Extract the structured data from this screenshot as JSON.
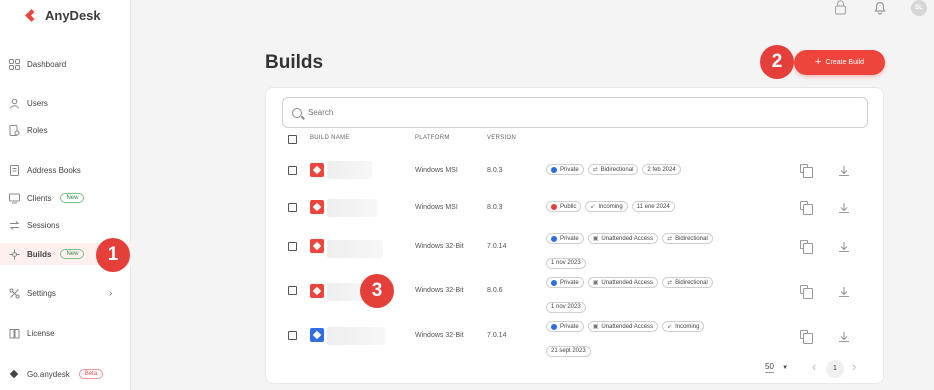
{
  "app": {
    "brand": "AnyDesk"
  },
  "sidebar": {
    "items": [
      {
        "label": "Dashboard",
        "icon": "grid-icon"
      },
      {
        "label": "Users",
        "icon": "user-icon"
      },
      {
        "label": "Roles",
        "icon": "roles-icon"
      },
      {
        "label": "Address Books",
        "icon": "address-book-icon"
      },
      {
        "label": "Clients",
        "icon": "monitor-icon",
        "badge": "New"
      },
      {
        "label": "Sessions",
        "icon": "sessions-icon"
      },
      {
        "label": "Builds",
        "icon": "builds-icon",
        "badge": "New",
        "active": true
      },
      {
        "label": "Settings",
        "icon": "settings-icon"
      },
      {
        "label": "License",
        "icon": "license-icon"
      },
      {
        "label": "Go.anydesk",
        "icon": "go-anydesk-icon",
        "badge": "Beta"
      }
    ]
  },
  "header": {
    "avatar_initials": "SL",
    "icons": [
      "lock-icon",
      "bell-icon"
    ]
  },
  "main": {
    "title": "Builds",
    "create_button": "Create Build",
    "search_placeholder": "Search",
    "columns": [
      "BUILD NAME",
      "PLATFORM",
      "VERSION"
    ],
    "rows": [
      {
        "icon_color": "red",
        "platform": "Windows MSI",
        "version": "8.0.3",
        "tags": [
          {
            "label": "Private",
            "dot": "blue"
          },
          {
            "label": "Bidirectional",
            "icon": "bidirectional-icon"
          },
          {
            "label": "2 feb 2024"
          }
        ]
      },
      {
        "icon_color": "red",
        "platform": "Windows MSI",
        "version": "8.0.3",
        "tags": [
          {
            "label": "Public",
            "dot": "red"
          },
          {
            "label": "Incoming",
            "icon": "incoming-icon"
          },
          {
            "label": "11 ene 2024"
          }
        ]
      },
      {
        "icon_color": "red",
        "platform": "Windows 32-Bit",
        "version": "7.0.14",
        "tags": [
          {
            "label": "Private",
            "dot": "blue"
          },
          {
            "label": "Unattended Access",
            "icon": "unattended-icon"
          },
          {
            "label": "Bidirectional",
            "icon": "bidirectional-icon"
          },
          {
            "label": "1 nov 2023"
          }
        ]
      },
      {
        "icon_color": "red",
        "platform": "Windows 32-Bit",
        "version": "8.0.6",
        "tags": [
          {
            "label": "Private",
            "dot": "blue"
          },
          {
            "label": "Unattended Access",
            "icon": "unattended-icon"
          },
          {
            "label": "Bidirectional",
            "icon": "bidirectional-icon"
          },
          {
            "label": "1 nov 2023"
          }
        ]
      },
      {
        "icon_color": "blue",
        "platform": "Windows 32-Bit",
        "version": "7.0.14",
        "tags": [
          {
            "label": "Private",
            "dot": "blue"
          },
          {
            "label": "Unattended Access",
            "icon": "unattended-icon"
          },
          {
            "label": "Incoming",
            "icon": "incoming-icon"
          },
          {
            "label": "21 sept 2023"
          }
        ]
      }
    ],
    "pagination": {
      "page_size": "50",
      "current_page": "1"
    }
  },
  "markers": [
    "1",
    "2",
    "3"
  ],
  "colors": {
    "accent": "#ef443b",
    "blue": "#2f6de1"
  }
}
